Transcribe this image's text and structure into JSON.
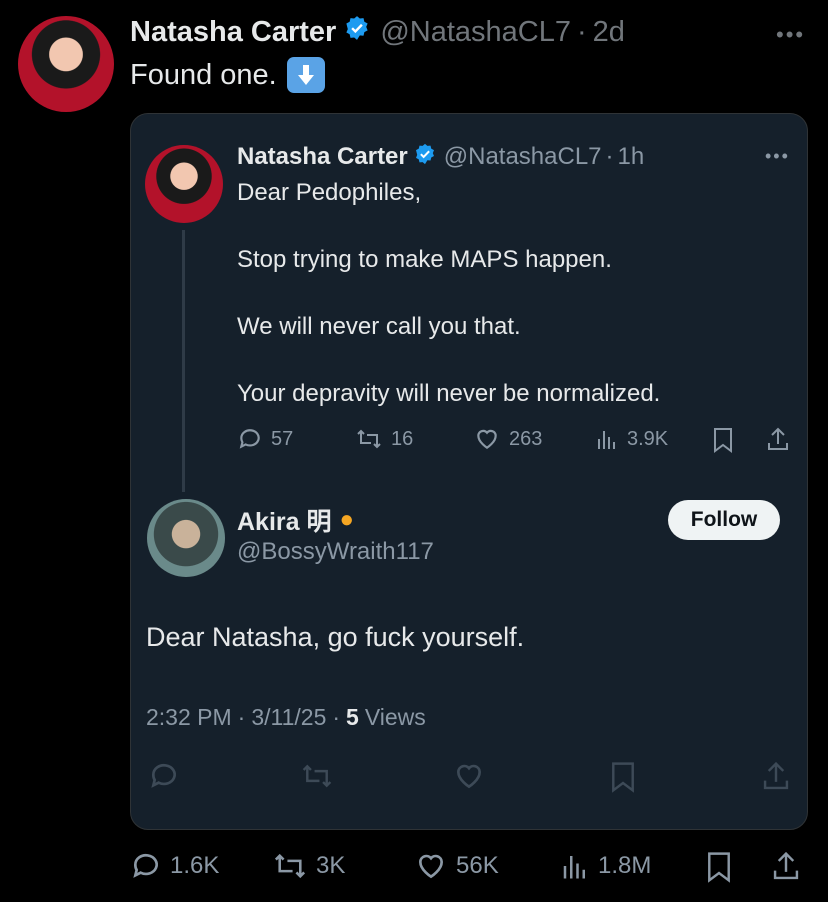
{
  "outer": {
    "name": "Natasha Carter",
    "handle": "@NatashaCL7",
    "time": "2d",
    "text": "Found one.",
    "emoji": "⬇️",
    "stats": {
      "replies": "1.6K",
      "reposts": "3K",
      "likes": "56K",
      "views": "1.8M"
    }
  },
  "quoted": {
    "name": "Natasha Carter",
    "handle": "@NatashaCL7",
    "time": "1h",
    "lines": [
      "Dear Pedophiles,",
      "Stop trying to make MAPS happen.",
      "We will never call you that.",
      "Your depravity will never be normalized."
    ],
    "stats": {
      "replies": "57",
      "reposts": "16",
      "likes": "263",
      "views": "3.9K"
    }
  },
  "reply": {
    "name": "Akira 明",
    "emoji": "🦁",
    "handle": "@BossyWraith117",
    "follow_label": "Follow",
    "text": "Dear Natasha, go fuck yourself.",
    "time": "2:32 PM",
    "date": "3/11/25",
    "views_count": "5",
    "views_label": "Views"
  },
  "colors": {
    "verified": "#1d9bf0",
    "muted": "#71767b",
    "card_bg": "#15202b"
  }
}
